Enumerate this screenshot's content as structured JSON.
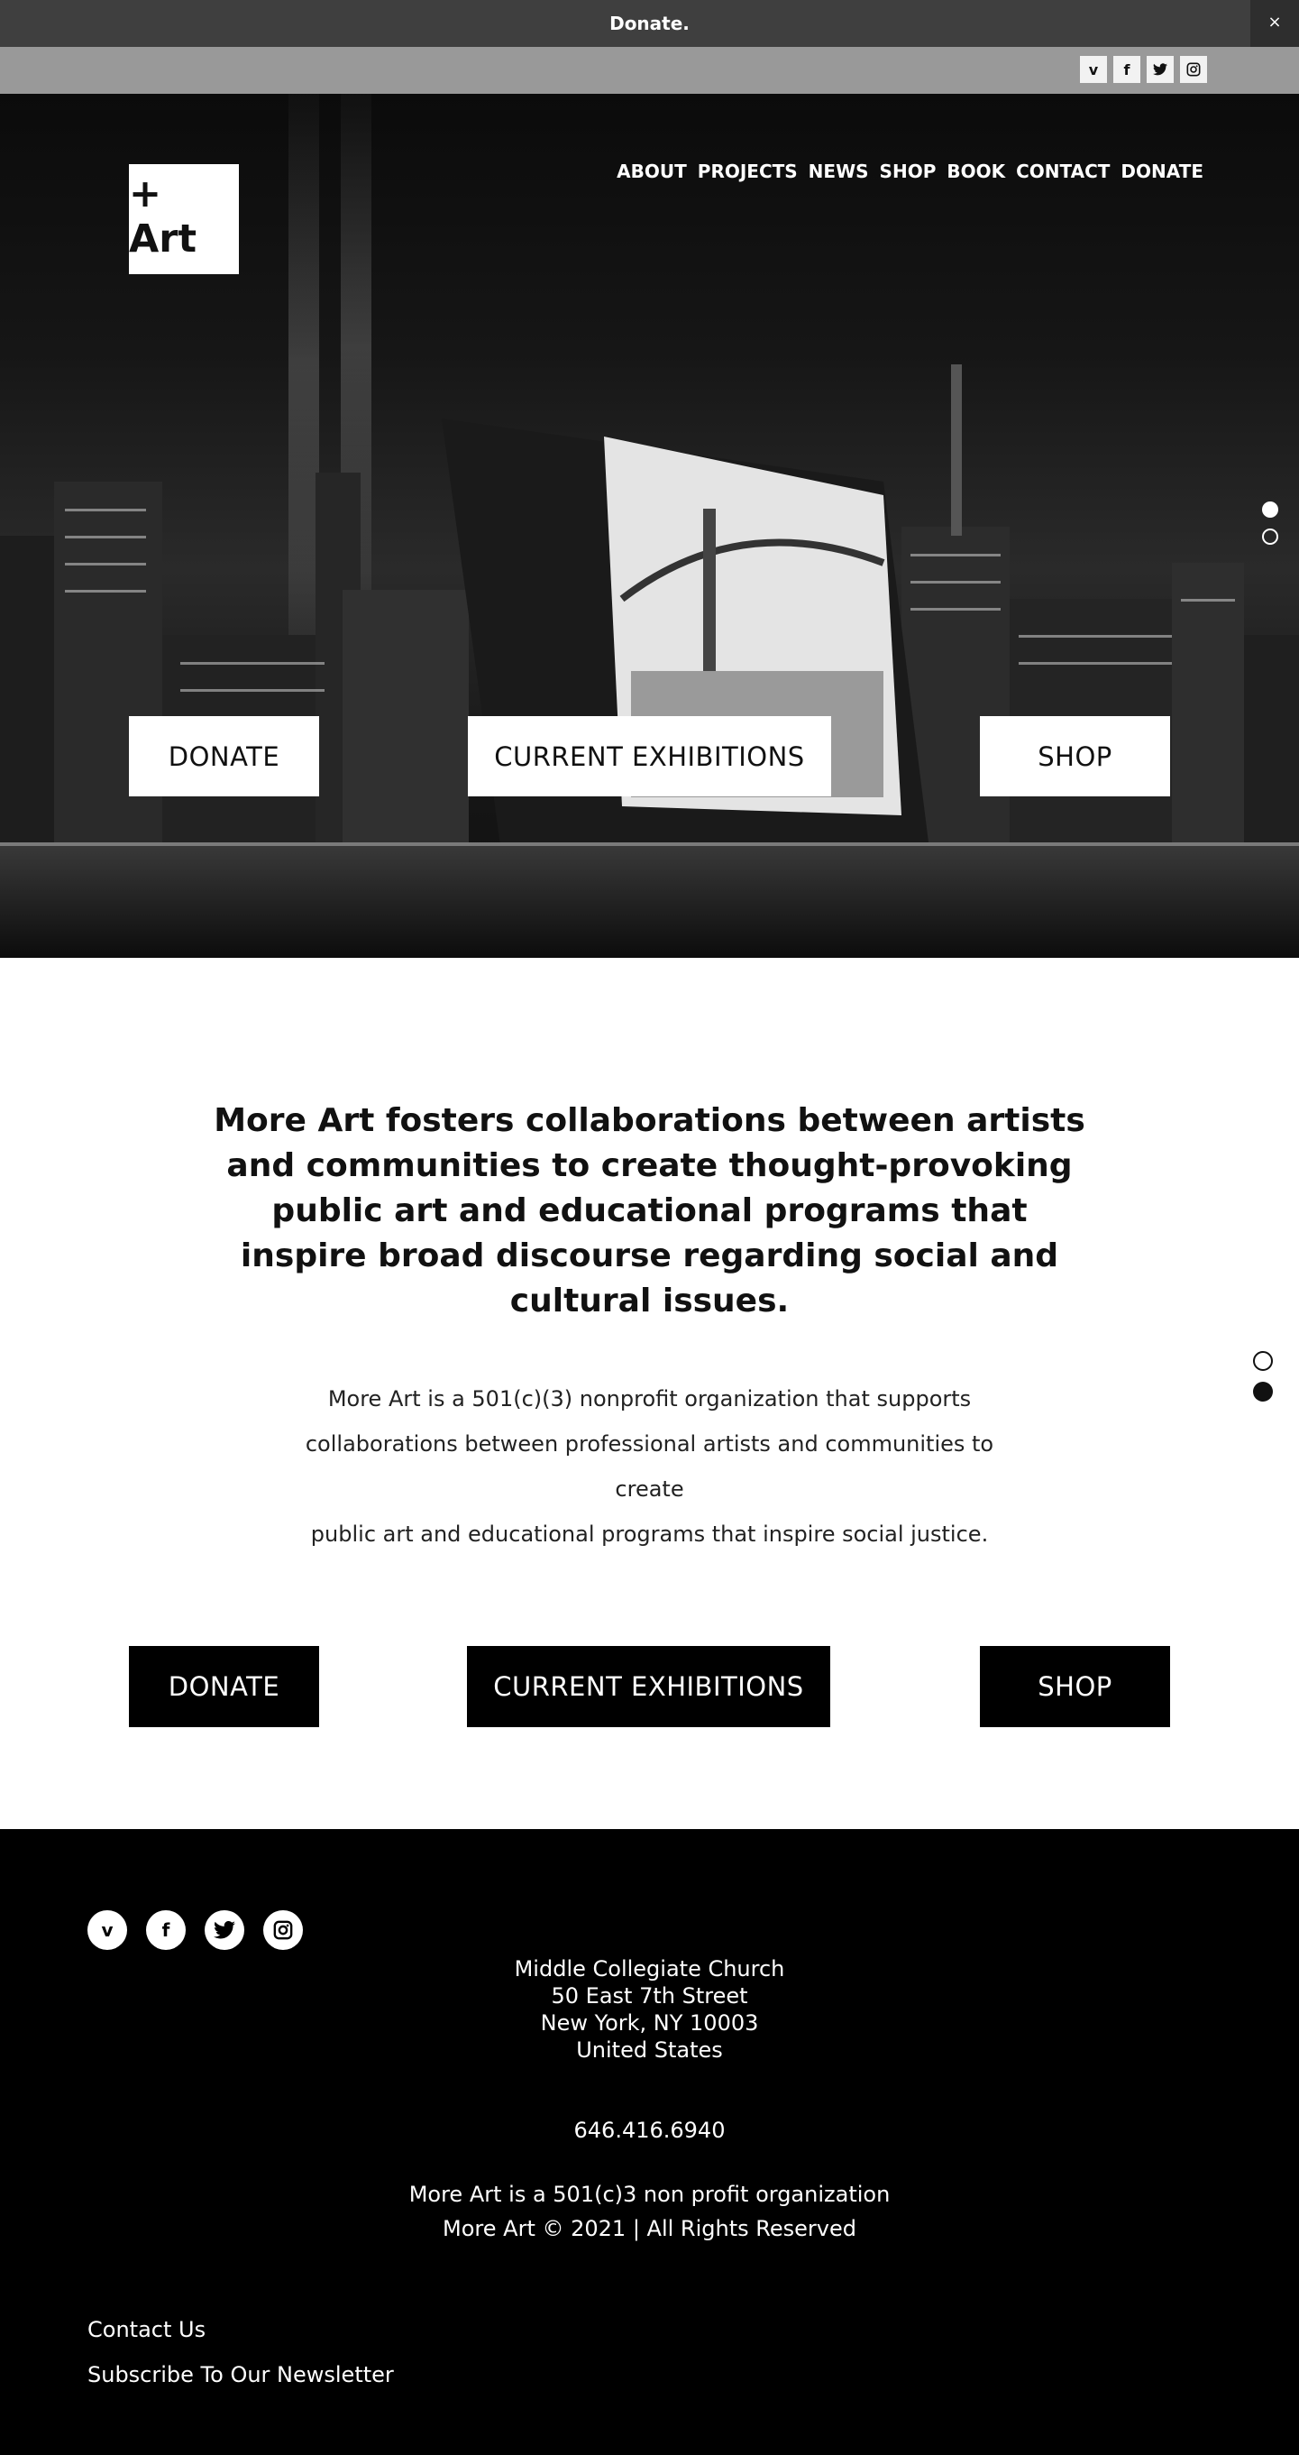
{
  "topbar": {
    "donate_text": "Donate.",
    "close_label": "×"
  },
  "social_bar": {
    "icons": [
      "vimeo-icon",
      "facebook-icon",
      "twitter-icon",
      "instagram-icon"
    ],
    "vimeo": "v",
    "facebook": "f",
    "twitter": "🐦",
    "instagram": "◎"
  },
  "header": {
    "logo": "+ Art",
    "nav": [
      "ABOUT",
      "PROJECTS",
      "NEWS",
      "SHOP",
      "BOOK",
      "CONTACT",
      "DONATE"
    ]
  },
  "hero": {
    "buttons": {
      "donate": "DONATE",
      "exhibitions": "CURRENT EXHIBITIONS",
      "shop": "SHOP"
    }
  },
  "intro": {
    "headline": "More Art fosters collaborations between artists and communities to create thought-provoking public art and educational programs that inspire broad discourse regarding social and cultural issues.",
    "body_lines": [
      "More Art is a 501(c)(3) nonprofit organization that supports",
      "collaborations between professional artists and communities to create",
      "public art and educational programs that inspire social justice."
    ]
  },
  "cta": {
    "donate": "DONATE",
    "exhibitions": "CURRENT EXHIBITIONS",
    "shop": "SHOP"
  },
  "footer": {
    "address": [
      "Middle Collegiate Church",
      "50 East 7th Street",
      "New York, NY 10003",
      "United States"
    ],
    "phone": "646.416.6940",
    "legal": [
      "More Art is a 501(c)3 non profit organization",
      "More Art © 2021 | All Rights Reserved"
    ],
    "links": {
      "contact": "Contact Us",
      "newsletter": "Subscribe To Our Newsletter"
    }
  },
  "colors": {
    "topbar": "#3f3f3f",
    "social_bar": "#999999",
    "footer": "#000000",
    "accent": "#000000"
  }
}
